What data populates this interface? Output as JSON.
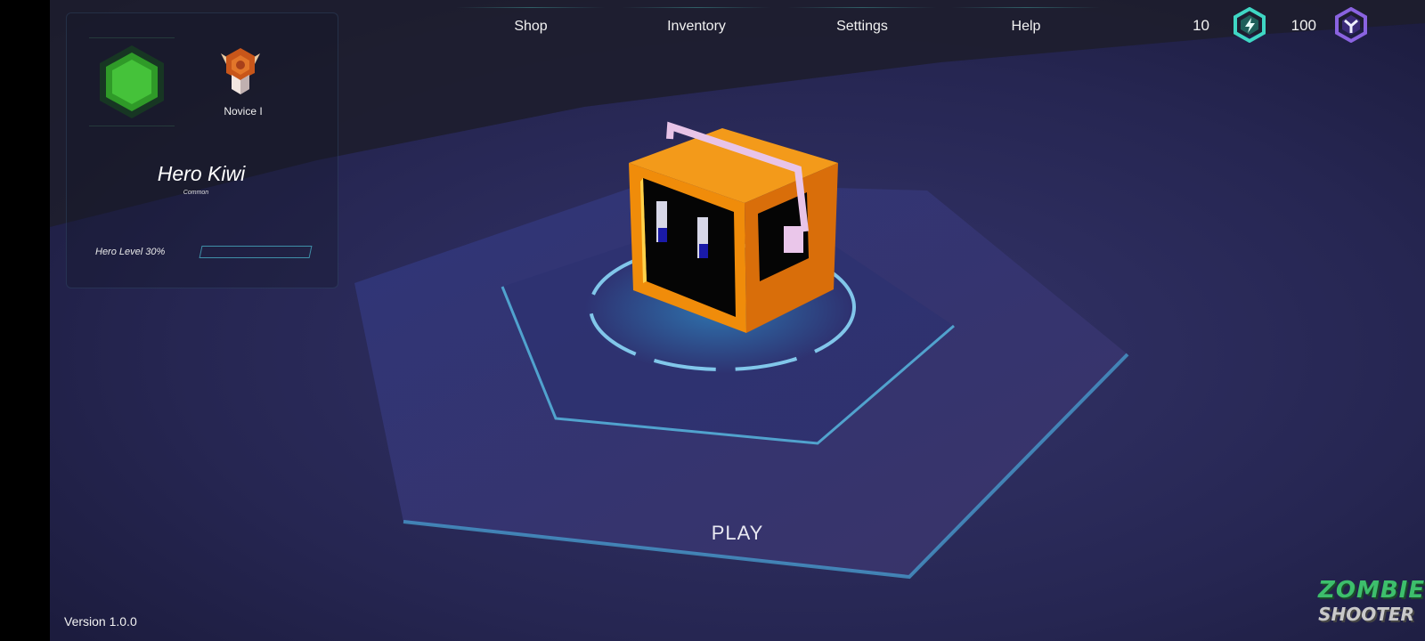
{
  "nav": [
    {
      "label": "Shop"
    },
    {
      "label": "Inventory"
    },
    {
      "label": "Settings"
    },
    {
      "label": "Help"
    }
  ],
  "currency": {
    "energy": {
      "value": "10",
      "icon": "lightning-hex-icon",
      "color": "#3fd6c4"
    },
    "gems": {
      "value": "100",
      "icon": "y-hex-icon",
      "color": "#8a63e0"
    }
  },
  "profile": {
    "avatar_icon": "green-hexagon-icon",
    "rank_label": "Novice I",
    "rank_icon": "rank-badge-icon",
    "hero_name": "Hero Kiwi",
    "hero_rarity": "Common",
    "level_label": "Hero Level 30%",
    "level_progress": 0.3
  },
  "play_label": "PLAY",
  "version": "Version 1.0.0",
  "logo": {
    "line1": "ZOMBIE",
    "line2": "SHOOTER"
  }
}
